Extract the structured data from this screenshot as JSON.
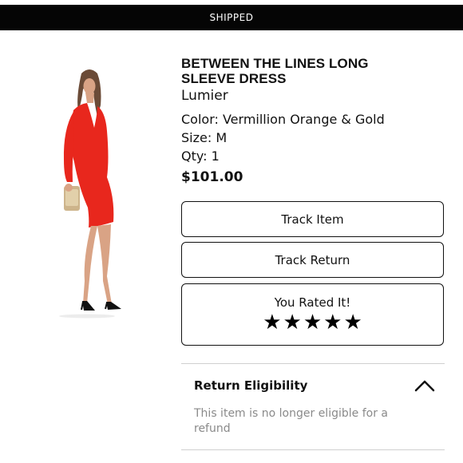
{
  "status_bar": {
    "label": "SHIPPED"
  },
  "product": {
    "title_line1": "BETWEEN THE LINES LONG",
    "title_line2": "SLEEVE DRESS",
    "brand": "Lumier",
    "color": "Color: Vermillion Orange & Gold",
    "size": "Size: M",
    "qty": "Qty: 1",
    "price": "$101.00",
    "image_icon": "red-dress-model-image"
  },
  "actions": {
    "track_item": "Track Item",
    "track_return": "Track Return"
  },
  "rating": {
    "label": "You Rated It!",
    "stars": 5,
    "max_stars": 5
  },
  "return_eligibility": {
    "heading": "Return Eligibility",
    "text": "This item is no longer eligible for a refund",
    "expanded": true,
    "icon": "chevron-up-icon"
  },
  "colors": {
    "status_bar_bg": "#050505",
    "dress": "#e8271d",
    "muted_text": "#8a8a8a"
  }
}
